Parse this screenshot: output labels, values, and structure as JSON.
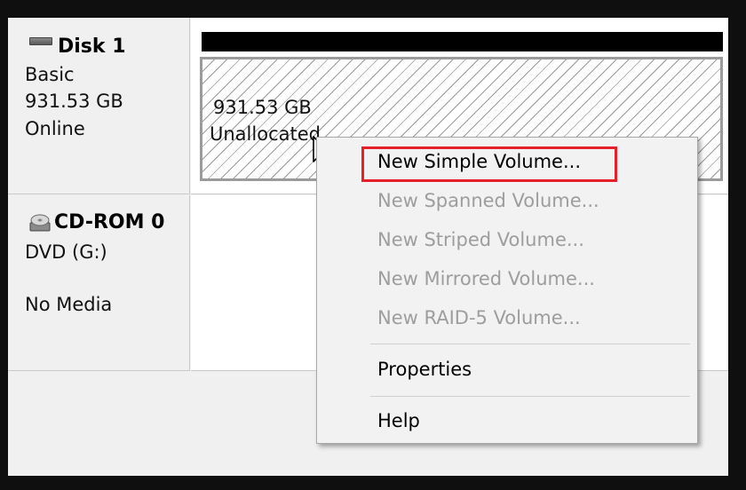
{
  "disks": [
    {
      "name": "Disk 1",
      "icon": "disk-icon",
      "type": "Basic",
      "size": "931.53 GB",
      "status": "Online",
      "partition": {
        "size": "931.53 GB",
        "label": "Unallocated"
      }
    },
    {
      "name": "CD-ROM 0",
      "icon": "cd-icon",
      "type": "DVD (G:)",
      "status": "No Media"
    }
  ],
  "context_menu": {
    "items": [
      {
        "label": "New Simple Volume...",
        "enabled": true,
        "highlighted": true
      },
      {
        "label": "New Spanned Volume...",
        "enabled": false
      },
      {
        "label": "New Striped Volume...",
        "enabled": false
      },
      {
        "label": "New Mirrored Volume...",
        "enabled": false
      },
      {
        "label": "New RAID-5 Volume...",
        "enabled": false
      },
      {
        "label": "Properties",
        "enabled": true
      },
      {
        "label": "Help",
        "enabled": true
      }
    ]
  },
  "colors": {
    "highlight_border": "#e5202a",
    "disabled_text": "#9d9d9d",
    "background": "#f0f0f0"
  }
}
